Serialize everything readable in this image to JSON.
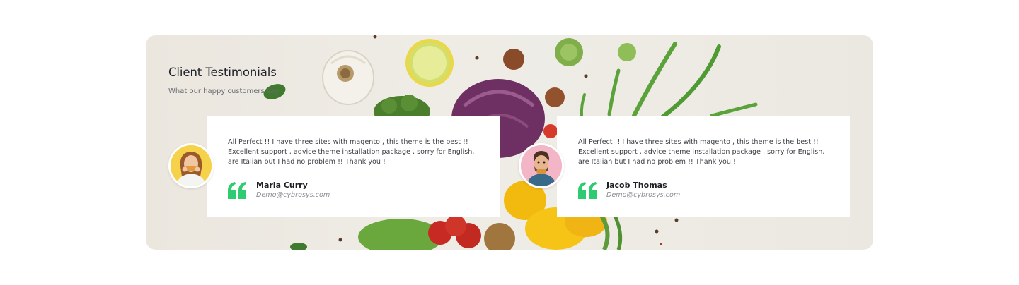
{
  "section": {
    "title": "Client Testimonials",
    "subtitle": "What our happy customers say"
  },
  "testimonials": [
    {
      "text": "All Perfect !! I have three sites with magento , this theme is the best !! Excellent support , advice theme installation package , sorry for English, are Italian but I had no problem !! Thank you !",
      "name": "Maria Curry",
      "email": "Demo@cybrosys.com"
    },
    {
      "text": "All Perfect !! I have three sites with magento , this theme is the best !! Excellent support , advice theme installation package , sorry for English, are Italian but I had no problem !! Thank you !",
      "name": "Jacob Thomas",
      "email": "Demo@cybrosys.com"
    }
  ],
  "colors": {
    "accent": "#2ecc71",
    "background": "#ebe7df"
  }
}
